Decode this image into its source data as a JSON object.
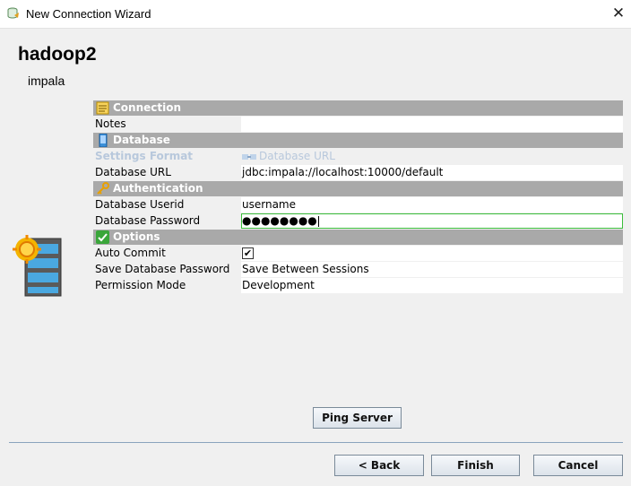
{
  "window": {
    "title": "New Connection Wizard",
    "close_glyph": "✕"
  },
  "connection": {
    "name": "hadoop2",
    "type": "impala"
  },
  "sections": {
    "connection": "Connection",
    "database": "Database",
    "authentication": "Authentication",
    "options": "Options"
  },
  "fields": {
    "notes": {
      "label": "Notes",
      "value": ""
    },
    "settings_format": {
      "label": "Settings Format",
      "value": "Database URL"
    },
    "database_url": {
      "label": "Database URL",
      "value": "jdbc:impala://localhost:10000/default"
    },
    "database_userid": {
      "label": "Database Userid",
      "value": "username"
    },
    "database_password": {
      "label": "Database Password",
      "value": "●●●●●●●●"
    },
    "auto_commit": {
      "label": "Auto Commit",
      "checked": true,
      "mark": "✔"
    },
    "save_password": {
      "label": "Save Database Password",
      "value": "Save Between Sessions"
    },
    "permission_mode": {
      "label": "Permission Mode",
      "value": "Development"
    }
  },
  "buttons": {
    "ping": "Ping Server",
    "back": "< Back",
    "finish": "Finish",
    "cancel": "Cancel"
  },
  "icons": {
    "app": "database-wizard-icon",
    "server": "database-server-icon",
    "connection": "note-icon",
    "database": "phone-device-icon",
    "authentication": "key-icon",
    "options": "checkmark-icon",
    "settings_format": "url-icon"
  },
  "colors": {
    "section_header": "#a9a9a9",
    "disabled_text": "#b8c8dc",
    "focus_border": "#3bbd3b"
  }
}
